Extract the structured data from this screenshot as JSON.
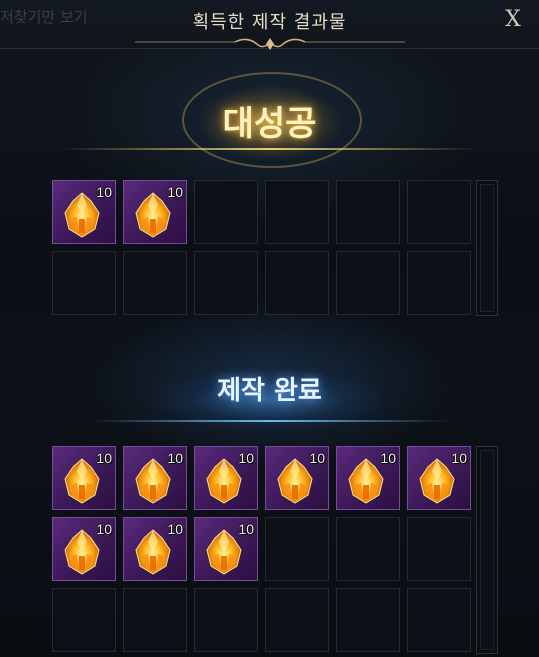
{
  "window": {
    "title": "획득한 제작 결과물",
    "close_label": "X",
    "background_text": "저찾기만 보기"
  },
  "great_success": {
    "label": "대성공",
    "items": [
      {
        "icon": "orange-crystal-icon",
        "count": "10"
      },
      {
        "icon": "orange-crystal-icon",
        "count": "10"
      }
    ],
    "slots_total": 12
  },
  "craft_complete": {
    "label": "제작 완료",
    "items": [
      {
        "icon": "orange-crystal-icon",
        "count": "10"
      },
      {
        "icon": "orange-crystal-icon",
        "count": "10"
      },
      {
        "icon": "orange-crystal-icon",
        "count": "10"
      },
      {
        "icon": "orange-crystal-icon",
        "count": "10"
      },
      {
        "icon": "orange-crystal-icon",
        "count": "10"
      },
      {
        "icon": "orange-crystal-icon",
        "count": "10"
      },
      {
        "icon": "orange-crystal-icon",
        "count": "10"
      },
      {
        "icon": "orange-crystal-icon",
        "count": "10"
      },
      {
        "icon": "orange-crystal-icon",
        "count": "10"
      }
    ],
    "slots_total": 18
  },
  "colors": {
    "gold_accent": "#ffd75a",
    "blue_accent": "#5aaaff",
    "slot_filled": "#5a2a7c"
  }
}
